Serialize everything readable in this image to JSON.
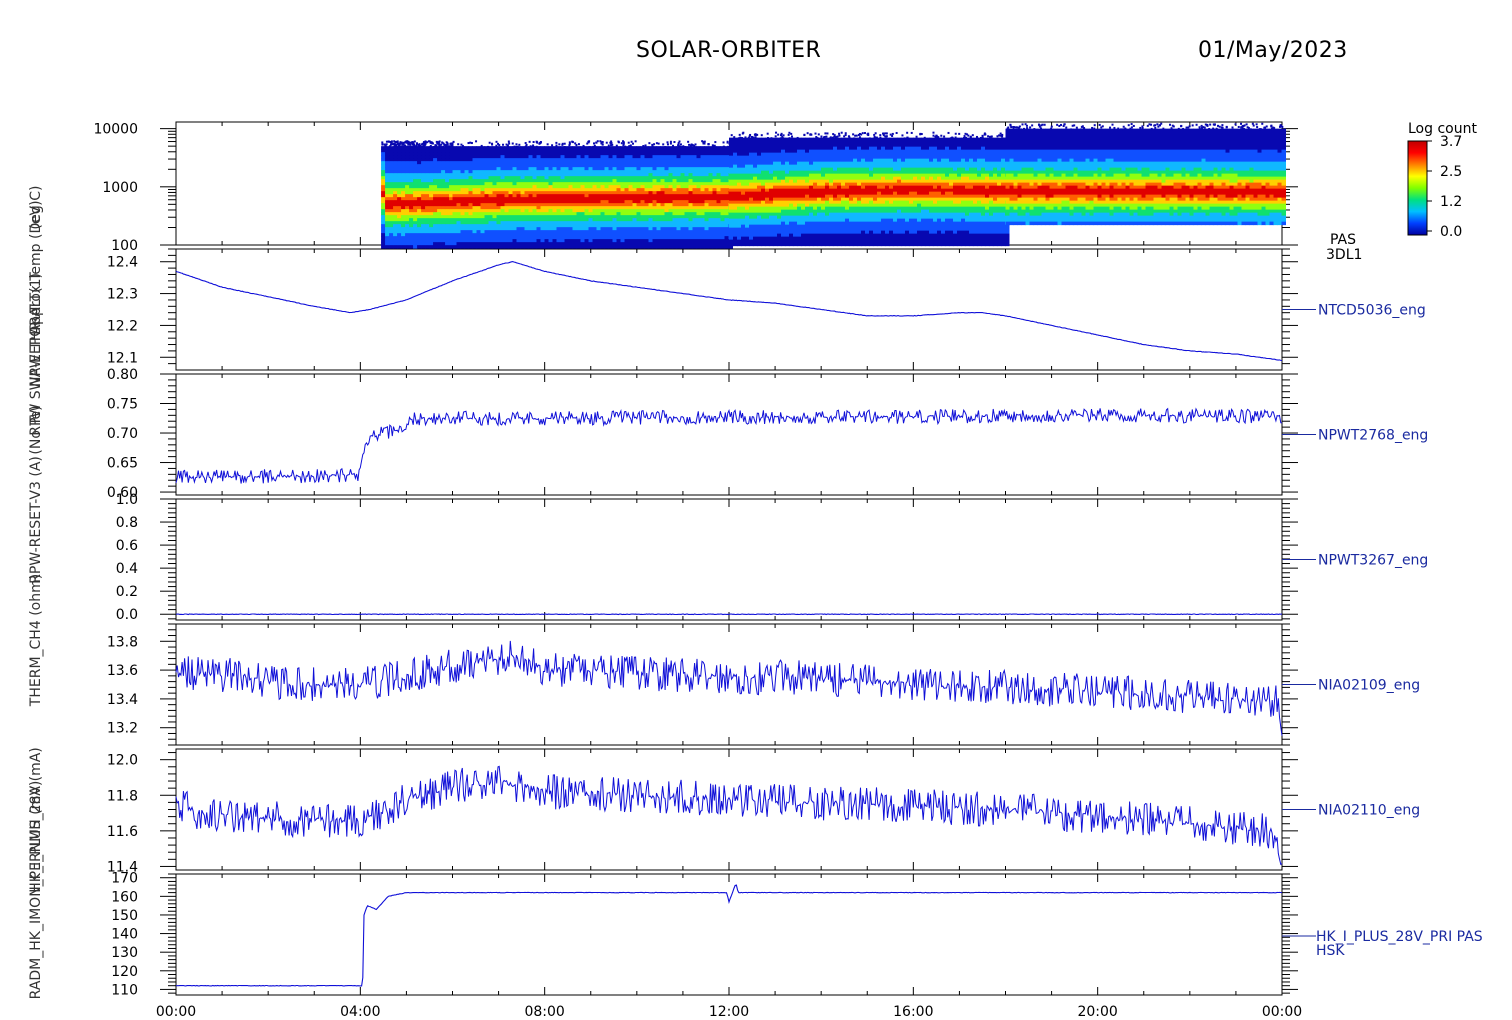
{
  "header": {
    "mission": "SOLAR-ORBITER",
    "date": "01/May/2023"
  },
  "time_axis": {
    "labels": [
      "00:00",
      "04:00",
      "08:00",
      "12:00",
      "16:00",
      "20:00",
      "00:00"
    ],
    "range_hours": [
      0,
      24
    ]
  },
  "left_axis_labels": [
    "(eV)",
    "Approx Temp (Deg C)",
    "NPW THR-ALT(1)",
    "RPW SWA-EEPOR-T",
    "(No Te)",
    "RPW-RESET-V3 (A)",
    "THERM_CH4 (ohm)",
    "HK_I_PLUS_28V (mA)",
    "RADM_HK_IMON_PERNMH (mA)"
  ],
  "colorbar": {
    "title": "Log count",
    "ticks": [
      "3.7",
      "2.5",
      "1.2",
      "0.0"
    ],
    "colors": [
      "#0000a0",
      "#0040ff",
      "#00c0ff",
      "#00e080",
      "#80ff00",
      "#ffff00",
      "#ff8000",
      "#ff0000",
      "#c00000"
    ]
  },
  "chart_data": [
    {
      "type": "heatmap",
      "name": "PAS 3DL1",
      "right_labels": [
        "PAS",
        "3DL1"
      ],
      "y_scale": "log",
      "ylim": [
        100,
        13000
      ],
      "yticks": [
        "10000",
        "1000",
        "100"
      ],
      "data_segments_hours": [
        [
          4.45,
          6.0
        ],
        [
          6.0,
          12.0
        ],
        [
          12.0,
          18.0
        ],
        [
          18.0,
          24.0
        ]
      ],
      "energy_range_eV": [
        [
          95,
          5000
        ],
        [
          95,
          5000
        ],
        [
          105,
          7000
        ],
        [
          250,
          10000
        ]
      ],
      "peak_energy_eV": [
        [
          4.45,
          520
        ],
        [
          7.3,
          650
        ],
        [
          11.5,
          700
        ],
        [
          12.5,
          750
        ],
        [
          14.0,
          880
        ],
        [
          16.0,
          950
        ],
        [
          18.0,
          880
        ],
        [
          22.0,
          880
        ],
        [
          24.0,
          850
        ]
      ],
      "color_scale": "Log count"
    },
    {
      "type": "line",
      "name": "NTCD5036_eng",
      "right_label": "NTCD5036_eng",
      "ylim": [
        12.06,
        12.44
      ],
      "yticks": [
        "12.4",
        "12.3",
        "12.2",
        "12.1"
      ],
      "x": [
        0,
        1,
        2,
        3,
        3.8,
        4.2,
        5,
        6,
        7,
        7.3,
        8,
        9,
        10,
        11,
        12,
        13,
        14,
        15,
        16,
        17,
        17.5,
        18,
        19,
        20,
        21,
        22,
        23,
        24
      ],
      "y": [
        12.37,
        12.32,
        12.29,
        12.26,
        12.24,
        12.25,
        12.28,
        12.34,
        12.39,
        12.4,
        12.37,
        12.34,
        12.32,
        12.3,
        12.28,
        12.27,
        12.25,
        12.23,
        12.23,
        12.24,
        12.24,
        12.23,
        12.2,
        12.17,
        12.14,
        12.12,
        12.11,
        12.09
      ]
    },
    {
      "type": "line",
      "name": "NPWT2768_eng",
      "right_label": "NPWT2768_eng",
      "ylim": [
        0.595,
        0.8
      ],
      "yticks": [
        "0.80",
        "0.75",
        "0.70",
        "0.65",
        "0.60"
      ],
      "x": [
        0,
        3.5,
        4.0,
        4.1,
        4.5,
        5.0,
        5.1,
        8,
        12,
        16,
        18,
        20,
        24
      ],
      "y": [
        0.625,
        0.628,
        0.63,
        0.69,
        0.7,
        0.705,
        0.725,
        0.725,
        0.727,
        0.727,
        0.73,
        0.73,
        0.728
      ],
      "noise": 0.012
    },
    {
      "type": "line",
      "name": "NPWT3267_eng",
      "right_label": "NPWT3267_eng",
      "ylim": [
        -0.05,
        1.0
      ],
      "yticks": [
        "1.0",
        "0.8",
        "0.6",
        "0.4",
        "0.2",
        "0.0"
      ],
      "x": [
        0,
        24
      ],
      "y": [
        0.0,
        0.0
      ]
    },
    {
      "type": "line",
      "name": "NIA02109_eng",
      "right_label": "NIA02109_eng",
      "ylim": [
        13.08,
        13.92
      ],
      "yticks": [
        "13.8",
        "13.6",
        "13.4",
        "13.2"
      ],
      "x": [
        0,
        0.1,
        1.5,
        2.3,
        4.0,
        4.9,
        6.0,
        7.0,
        7.5,
        8.0,
        10,
        12,
        13.5,
        16,
        18,
        20,
        22,
        23.9,
        24
      ],
      "y": [
        13.65,
        13.58,
        13.56,
        13.5,
        13.5,
        13.55,
        13.63,
        13.68,
        13.7,
        13.6,
        13.58,
        13.55,
        13.55,
        13.5,
        13.48,
        13.45,
        13.42,
        13.38,
        13.15
      ],
      "noise": 0.12
    },
    {
      "type": "line",
      "name": "NIA02110_eng",
      "right_label": "NIA02110_eng",
      "ylim": [
        11.38,
        12.06
      ],
      "yticks": [
        "12.0",
        "11.8",
        "11.6",
        "11.4"
      ],
      "x": [
        0,
        0.1,
        1.0,
        3.0,
        4.1,
        4.5,
        5.0,
        6.0,
        7.0,
        8.0,
        10,
        12,
        13.5,
        16,
        18,
        20,
        22,
        23.8,
        24
      ],
      "y": [
        11.78,
        11.73,
        11.68,
        11.66,
        11.66,
        11.7,
        11.78,
        11.85,
        11.88,
        11.82,
        11.8,
        11.78,
        11.76,
        11.74,
        11.72,
        11.68,
        11.64,
        11.6,
        11.4
      ],
      "noise": 0.1
    },
    {
      "type": "line",
      "name": "HK_I_PLUS_28V_PRI PAS HSK",
      "right_labels": [
        "HK_I_PLUS_28V_PRI PAS",
        "HSK"
      ],
      "ylim": [
        107,
        172
      ],
      "yticks": [
        "170",
        "160",
        "150",
        "140",
        "130",
        "120",
        "110"
      ],
      "x": [
        0,
        4.05,
        4.08,
        4.15,
        4.35,
        4.6,
        5.0,
        11.95,
        12.0,
        12.15,
        12.2,
        24
      ],
      "y": [
        112,
        112,
        150,
        155,
        153,
        160,
        162,
        162,
        157,
        167,
        162,
        162
      ]
    }
  ]
}
